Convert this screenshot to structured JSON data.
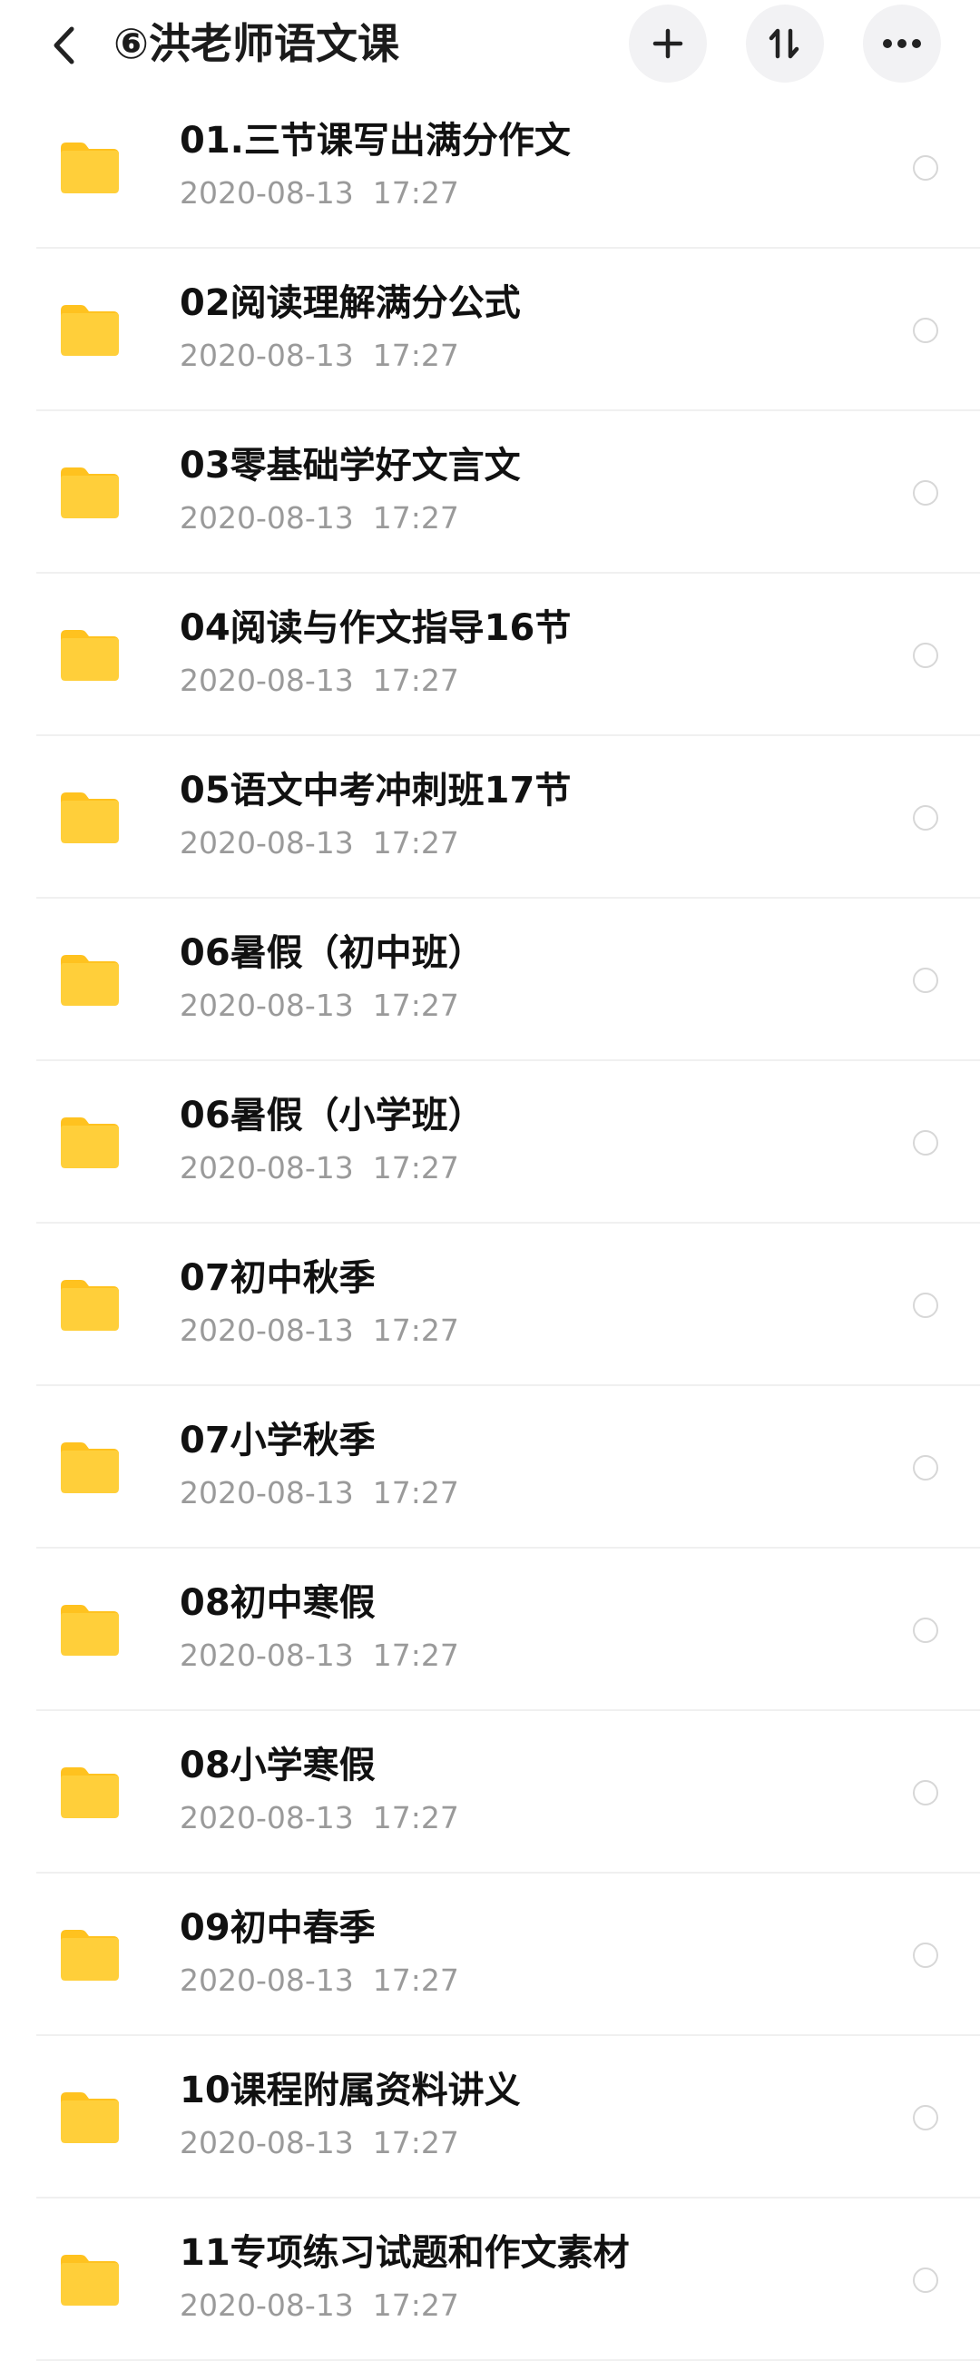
{
  "header": {
    "title": "⑥洪老师语文课",
    "back_icon": "chevron-left-icon",
    "add_icon": "plus-icon",
    "sort_icon": "sort-icon",
    "more_icon": "more-horizontal-icon"
  },
  "colors": {
    "folder": "#FFCF3A",
    "folder_tab": "#FFC21F",
    "button_bg": "#F2F2F4"
  },
  "files": [
    {
      "name": "01.三节课写出满分作文",
      "date": "2020-08-13  17:27"
    },
    {
      "name": "02阅读理解满分公式",
      "date": "2020-08-13  17:27"
    },
    {
      "name": "03零基础学好文言文",
      "date": "2020-08-13  17:27"
    },
    {
      "name": "04阅读与作文指导16节",
      "date": "2020-08-13  17:27"
    },
    {
      "name": "05语文中考冲刺班17节",
      "date": "2020-08-13  17:27"
    },
    {
      "name": "06暑假（初中班）",
      "date": "2020-08-13  17:27"
    },
    {
      "name": "06暑假（小学班）",
      "date": "2020-08-13  17:27"
    },
    {
      "name": "07初中秋季",
      "date": "2020-08-13  17:27"
    },
    {
      "name": "07小学秋季",
      "date": "2020-08-13  17:27"
    },
    {
      "name": "08初中寒假",
      "date": "2020-08-13  17:27"
    },
    {
      "name": "08小学寒假",
      "date": "2020-08-13  17:27"
    },
    {
      "name": "09初中春季",
      "date": "2020-08-13  17:27"
    },
    {
      "name": "10课程附属资料讲义",
      "date": "2020-08-13  17:27"
    },
    {
      "name": "11专项练习试题和作文素材",
      "date": "2020-08-13  17:27"
    }
  ]
}
